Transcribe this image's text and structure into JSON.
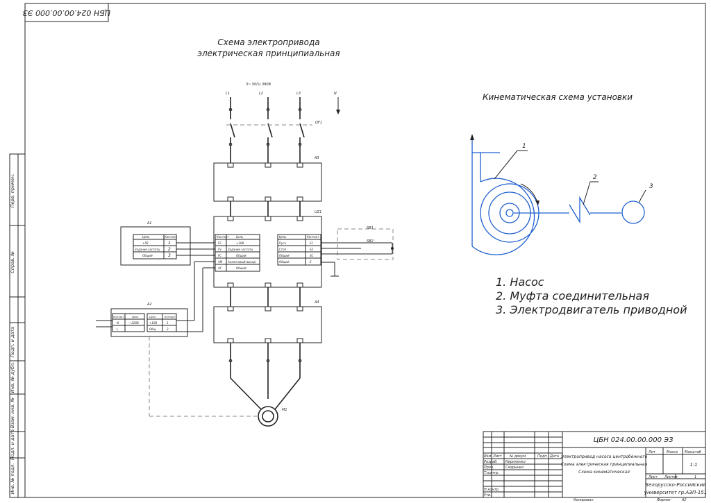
{
  "stamp_rotated": "ЦБН 024.00.00.000 ЭЗ",
  "schema_title_line1": "Схема электропривода",
  "schema_title_line2": "электрическая принципиальная",
  "kinematic_title": "Кинематическая схема установки",
  "legend": [
    "1. Насос",
    "2. Муфта соединительная",
    "3. Электродвигатель приводной"
  ],
  "kinematic_labels": [
    "1",
    "2",
    "3"
  ],
  "supply_label": "3~ 50Гц 380В",
  "phases": [
    "L1",
    "L2",
    "L3"
  ],
  "phase_n": "N",
  "breaker": "QF1",
  "a3": "A3",
  "uz1": "UZ1",
  "a4": "A4",
  "motor": "M1",
  "a1": "A1",
  "a2": "A2",
  "a1_table": {
    "headers": [
      "Цепь",
      "Контакт"
    ],
    "rows": [
      [
        "+5В",
        "1"
      ],
      [
        "Задание частоты",
        "2"
      ],
      [
        "Общий",
        "3"
      ]
    ]
  },
  "uz_left_table": {
    "headers": [
      "Контакт",
      "Цепь"
    ],
    "rows": [
      [
        "FS",
        "+10В"
      ],
      [
        "FV",
        "Задание частоты"
      ],
      [
        "FC",
        "Общий"
      ],
      [
        "AM",
        "Аналоговый выход"
      ],
      [
        "AC",
        "Общий"
      ]
    ]
  },
  "uz_right_table": {
    "headers": [
      "Цепь",
      "Контакт"
    ],
    "rows": [
      [
        "Пуск",
        "S1"
      ],
      [
        "Стоп",
        "S2"
      ],
      [
        "Общий",
        "SC"
      ],
      [
        "Общий",
        "E"
      ]
    ]
  },
  "a2_table": {
    "headers": [
      "Контакт",
      "Цепь",
      "Цепь",
      "Контакт"
    ],
    "rows": [
      [
        "N",
        "~220В",
        "+10В",
        "1"
      ],
      [
        "L",
        "",
        "Общ.",
        "3"
      ]
    ]
  },
  "buttons": [
    "SB1",
    "SB2"
  ],
  "title_block": {
    "code": "ЦБН 024.00.00.000 ЭЗ",
    "name_lines": [
      "Электропривод насоса центробежного",
      "Схема электрическая принципиальная",
      "Схема кинематическая"
    ],
    "headers": [
      "Изм",
      "Лист",
      "№ докум.",
      "Подп.",
      "Дата"
    ],
    "roles": [
      "Разраб.",
      "Пров.",
      "Т.контр.",
      "",
      "Н.контр.",
      "Утв."
    ],
    "names": [
      "Кириленко",
      "Скорынко"
    ],
    "lit": "Лит",
    "mass": "Масса",
    "scale": "Масштаб",
    "scale_value": "1:1",
    "sheet": "Лист",
    "sheets": "Листов",
    "sheets_value": "1",
    "org_line1": "Белорусско-Российский",
    "org_line2": "университет гр.АЭП-151",
    "copied": "Копировал",
    "format": "Формат",
    "format_value": "А2"
  },
  "side_labels": [
    "Перв. примен.",
    "Справ. №",
    "Подп. и дата",
    "Инв. № дубл.",
    "Взам. инв. №",
    "Подп. и дата",
    "Инв. № подл."
  ]
}
